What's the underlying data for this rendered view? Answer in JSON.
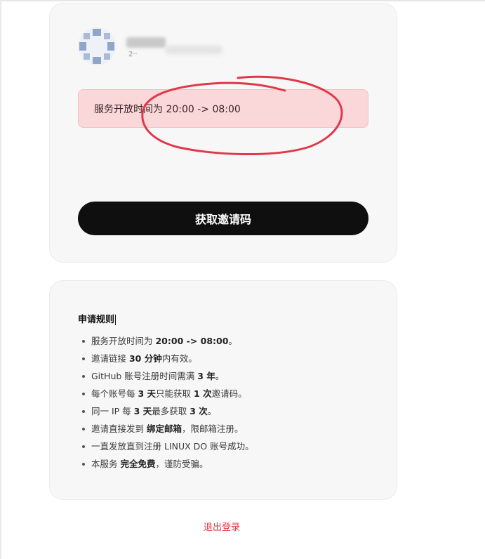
{
  "user": {
    "name": "——",
    "subtitle": "2··"
  },
  "alert": {
    "text": "服务开放时间为 20:00 -> 08:00"
  },
  "invite_button": {
    "label": "获取邀请码"
  },
  "rules": {
    "title": "申请规则",
    "items": [
      [
        {
          "t": "服务开放时间为 "
        },
        {
          "t": "20:00 -> 08:00",
          "b": true
        },
        {
          "t": "。"
        }
      ],
      [
        {
          "t": "邀请链接 "
        },
        {
          "t": "30 分钟",
          "b": true
        },
        {
          "t": "内有效。"
        }
      ],
      [
        {
          "t": "GitHub 账号注册时间需满 "
        },
        {
          "t": "3 年",
          "b": true
        },
        {
          "t": "。"
        }
      ],
      [
        {
          "t": "每个账号每 "
        },
        {
          "t": "3 天",
          "b": true
        },
        {
          "t": "只能获取 "
        },
        {
          "t": "1 次",
          "b": true
        },
        {
          "t": "邀请码。"
        }
      ],
      [
        {
          "t": "同一 IP 每 "
        },
        {
          "t": "3 天",
          "b": true
        },
        {
          "t": "最多获取 "
        },
        {
          "t": "3 次",
          "b": true
        },
        {
          "t": "。"
        }
      ],
      [
        {
          "t": "邀请直接发到 "
        },
        {
          "t": "绑定邮箱",
          "b": true
        },
        {
          "t": "，限邮箱注册。"
        }
      ],
      [
        {
          "t": "一直发放直到注册 LINUX DO 账号成功。"
        }
      ],
      [
        {
          "t": "本服务 "
        },
        {
          "t": "完全免费",
          "b": true
        },
        {
          "t": "，谨防受骗。"
        }
      ]
    ]
  },
  "logout": {
    "label": "退出登录"
  },
  "colors": {
    "alert_bg": "#fad7d9",
    "primary_button": "#0f0f0f",
    "logout_link": "#e0393e",
    "annotation": "#e0394a"
  }
}
